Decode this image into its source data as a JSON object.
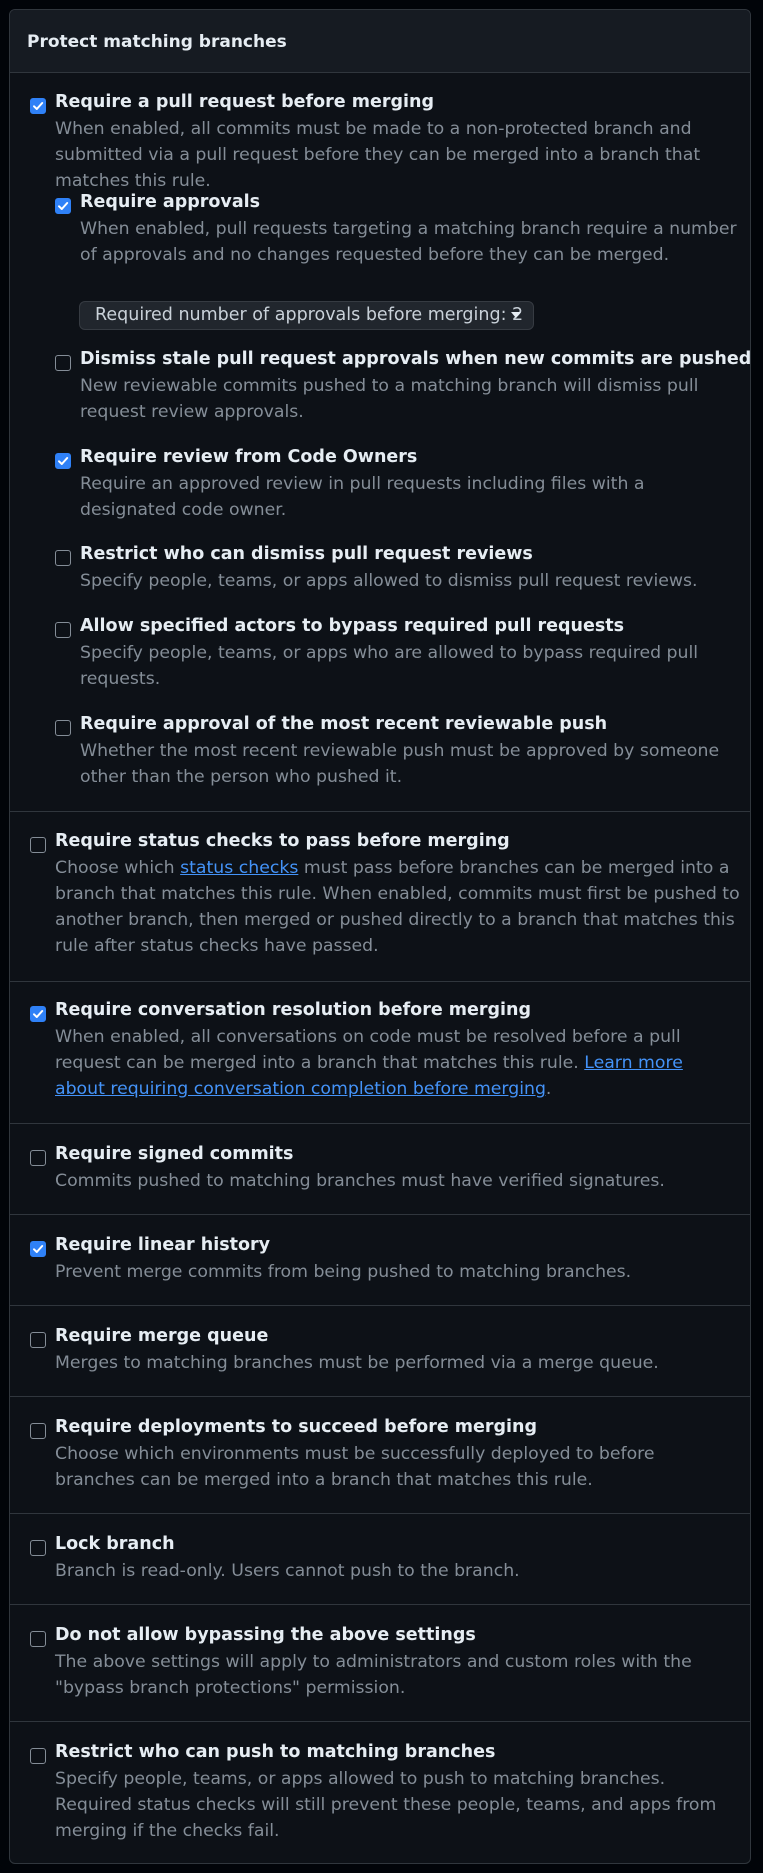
{
  "panel": {
    "title": "Protect matching branches"
  },
  "rules": {
    "pr": {
      "label": "Require a pull request before merging",
      "desc": "When enabled, all commits must be made to a non-protected branch and submitted via a pull request before they can be merged into a branch that matches this rule.",
      "checked": true,
      "sub": {
        "approvals": {
          "label": "Require approvals",
          "desc": "When enabled, pull requests targeting a matching branch require a number of approvals and no changes requested before they can be merged.",
          "checked": true,
          "select_label": "Required number of approvals before merging: 2"
        },
        "dismiss_stale": {
          "label": "Dismiss stale pull request approvals when new commits are pushed",
          "desc": "New reviewable commits pushed to a matching branch will dismiss pull request review approvals.",
          "checked": false
        },
        "code_owners": {
          "label": "Require review from Code Owners",
          "desc": "Require an approved review in pull requests including files with a designated code owner.",
          "checked": true
        },
        "restrict_dismiss": {
          "label": "Restrict who can dismiss pull request reviews",
          "desc": "Specify people, teams, or apps allowed to dismiss pull request reviews.",
          "checked": false
        },
        "bypass_actors": {
          "label": "Allow specified actors to bypass required pull requests",
          "desc": "Specify people, teams, or apps who are allowed to bypass required pull requests.",
          "checked": false
        },
        "recent_push": {
          "label": "Require approval of the most recent reviewable push",
          "desc": "Whether the most recent reviewable push must be approved by someone other than the person who pushed it.",
          "checked": false
        }
      }
    },
    "status_checks": {
      "label": "Require status checks to pass before merging",
      "desc_before": "Choose which ",
      "desc_link": "status checks",
      "desc_after": " must pass before branches can be merged into a branch that matches this rule. When enabled, commits must first be pushed to another branch, then merged or pushed directly to a branch that matches this rule after status checks have passed.",
      "checked": false
    },
    "conversation": {
      "label": "Require conversation resolution before merging",
      "desc_before": "When enabled, all conversations on code must be resolved before a pull request can be merged into a branch that matches this rule. ",
      "desc_link": "Learn more about requiring conversation completion before merging",
      "desc_after": ".",
      "checked": true
    },
    "signed": {
      "label": "Require signed commits",
      "desc": "Commits pushed to matching branches must have verified signatures.",
      "checked": false
    },
    "linear": {
      "label": "Require linear history",
      "desc": "Prevent merge commits from being pushed to matching branches.",
      "checked": true
    },
    "merge_queue": {
      "label": "Require merge queue",
      "desc": "Merges to matching branches must be performed via a merge queue.",
      "checked": false
    },
    "deployments": {
      "label": "Require deployments to succeed before merging",
      "desc": "Choose which environments must be successfully deployed to before branches can be merged into a branch that matches this rule.",
      "checked": false
    },
    "lock": {
      "label": "Lock branch",
      "desc": "Branch is read-only. Users cannot push to the branch.",
      "checked": false
    },
    "no_bypass": {
      "label": "Do not allow bypassing the above settings",
      "desc": "The above settings will apply to administrators and custom roles with the \"bypass branch protections\" permission.",
      "checked": false
    },
    "restrict_push": {
      "label": "Restrict who can push to matching branches",
      "desc": "Specify people, teams, or apps allowed to push to matching branches. Required status checks will still prevent these people, teams, and apps from merging if the checks fail.",
      "checked": false
    }
  },
  "colors": {
    "accent": "#2f81f7",
    "link": "#4493f8",
    "muted_text": "#848d97",
    "border": "#30363d"
  }
}
